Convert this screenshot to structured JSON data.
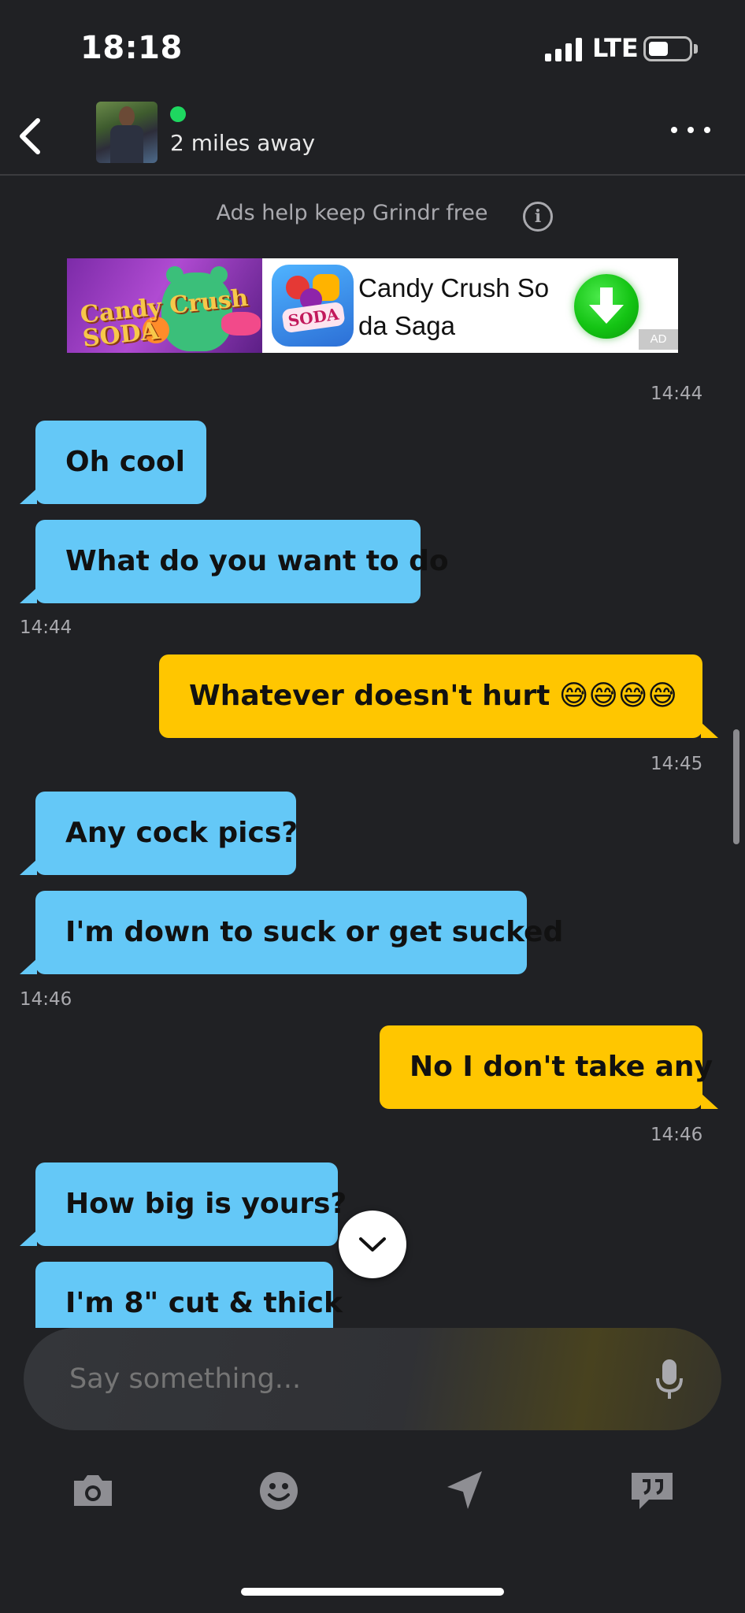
{
  "status_bar": {
    "time": "18:18",
    "network": "LTE"
  },
  "header": {
    "online": true,
    "distance": "2 miles away",
    "icons": [
      "back-arrow-icon",
      "more-options-icon"
    ]
  },
  "ad": {
    "note": "Ads help keep Grindr free",
    "app_name": "Candy Crush Soda Saga",
    "tag": "AD",
    "art_text": "Candy Crush SODA",
    "icon_text": "SODA",
    "download_color": "#14c414"
  },
  "messages": [
    {
      "type": "timestamp",
      "side": "right",
      "text": "14:44"
    },
    {
      "type": "bubble",
      "side": "in",
      "text": "Oh cool"
    },
    {
      "type": "bubble",
      "side": "in",
      "text": "What do you want to do"
    },
    {
      "type": "timestamp",
      "side": "left",
      "text": "14:44"
    },
    {
      "type": "bubble",
      "side": "out",
      "text": "Whatever  doesn't hurt",
      "emoji": "😅😅😅😅"
    },
    {
      "type": "timestamp",
      "side": "right",
      "text": "14:45"
    },
    {
      "type": "bubble",
      "side": "in",
      "text": "Any cock pics?"
    },
    {
      "type": "bubble",
      "side": "in",
      "text": "I'm down to suck or get sucked"
    },
    {
      "type": "timestamp",
      "side": "left",
      "text": "14:46"
    },
    {
      "type": "bubble",
      "side": "out",
      "text": "No I don't take any"
    },
    {
      "type": "timestamp",
      "side": "right",
      "text": "14:46"
    },
    {
      "type": "bubble",
      "side": "in",
      "text": "How big is yours?"
    },
    {
      "type": "bubble",
      "side": "in",
      "text": "I'm 8\" cut & thick"
    }
  ],
  "composer": {
    "placeholder": "Say something..."
  },
  "toolbar": {
    "items": [
      "camera-icon",
      "emoji-icon",
      "location-icon",
      "saved-phrases-icon"
    ]
  },
  "colors": {
    "background": "#202124",
    "incoming_bubble": "#64c8f7",
    "outgoing_bubble": "#ffc600",
    "online": "#1ed760"
  }
}
